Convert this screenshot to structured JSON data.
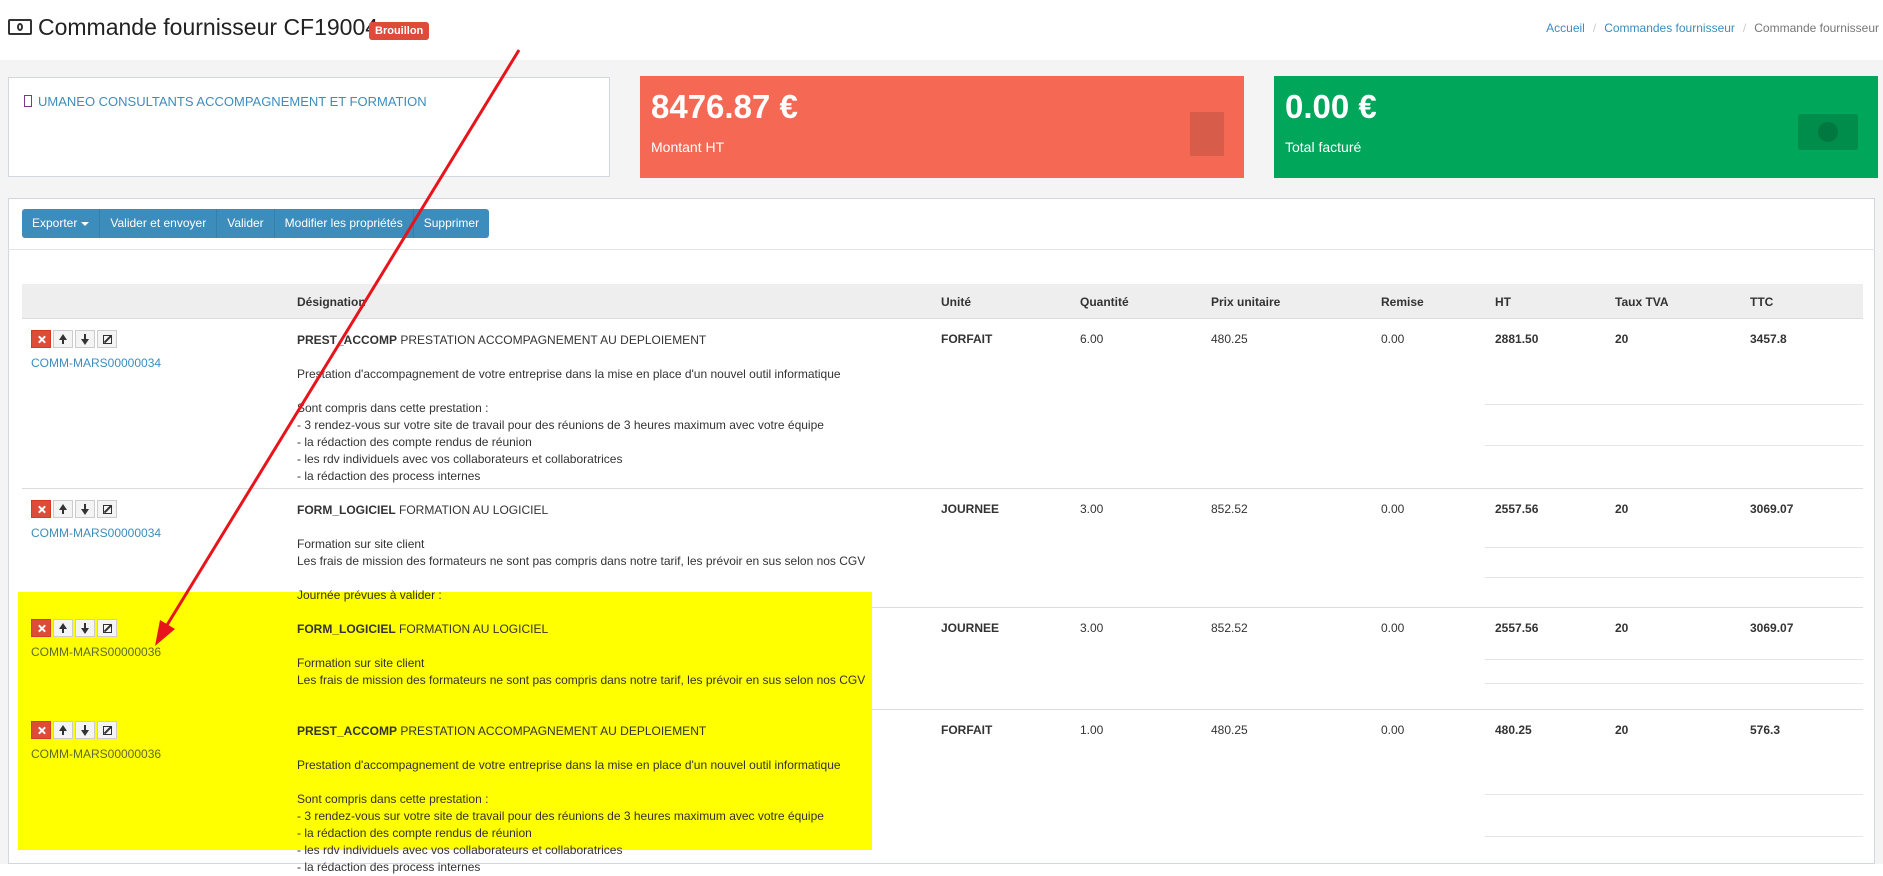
{
  "header": {
    "title": "Commande fournisseur CF19004",
    "status": "Brouillon",
    "breadcrumb": [
      "Accueil",
      "Commandes fournisseur",
      "Commande fournisseur"
    ]
  },
  "supplier": {
    "name": "UMANEO CONSULTANTS ACCOMPAGNEMENT ET FORMATION"
  },
  "kpis": [
    {
      "value": "8476.87 €",
      "label": "Montant HT",
      "color": "#f56954"
    },
    {
      "value": "0.00 €",
      "label": "Total facturé",
      "color": "#00a65a"
    }
  ],
  "toolbar": {
    "export": "Exporter",
    "validate_send": "Valider et envoyer",
    "validate": "Valider",
    "modify": "Modifier les propriétés",
    "delete": "Supprimer"
  },
  "table": {
    "headers": {
      "designation": "Désignation",
      "unit": "Unité",
      "qty": "Quantité",
      "price": "Prix unitaire",
      "discount": "Remise",
      "ht": "HT",
      "vat": "Taux TVA",
      "ttc": "TTC"
    },
    "rows": [
      {
        "ref": "COMM-MARS00000034",
        "code": "PREST_ACCOMP",
        "label": "PRESTATION ACCOMPAGNEMENT AU DEPLOIEMENT",
        "description": "Prestation d'accompagnement de votre entreprise dans la mise en place d'un nouvel outil informatique\n\nSont compris dans cette prestation :\n- 3 rendez-vous sur votre site de travail pour des réunions de 3 heures maximum avec votre équipe\n- la rédaction des compte rendus de réunion\n- les rdv individuels avec vos collaborateurs et collaboratrices\n- la rédaction des process internes",
        "unit": "FORFAIT",
        "qty": "6.00",
        "price": "480.25",
        "discount": "0.00",
        "ht": "2881.50",
        "vat": "20",
        "ttc": "3457.8"
      },
      {
        "ref": "COMM-MARS00000034",
        "code": "FORM_LOGICIEL",
        "label": "FORMATION AU LOGICIEL",
        "description": "Formation sur site client\nLes frais de mission des formateurs ne sont pas compris dans notre tarif, les prévoir en sus selon nos CGV\n\nJournée prévues à valider :",
        "unit": "JOURNEE",
        "qty": "3.00",
        "price": "852.52",
        "discount": "0.00",
        "ht": "2557.56",
        "vat": "20",
        "ttc": "3069.07"
      },
      {
        "ref": "COMM-MARS00000036",
        "code": "FORM_LOGICIEL",
        "label": "FORMATION AU LOGICIEL",
        "description": "Formation sur site client\nLes frais de mission des formateurs ne sont pas compris dans notre tarif, les prévoir en sus selon nos CGV",
        "unit": "JOURNEE",
        "qty": "3.00",
        "price": "852.52",
        "discount": "0.00",
        "ht": "2557.56",
        "vat": "20",
        "ttc": "3069.07"
      },
      {
        "ref": "COMM-MARS00000036",
        "code": "PREST_ACCOMP",
        "label": "PRESTATION ACCOMPAGNEMENT AU DEPLOIEMENT",
        "description": "Prestation d'accompagnement de votre entreprise dans la mise en place d'un nouvel outil informatique\n\nSont compris dans cette prestation :\n- 3 rendez-vous sur votre site de travail pour des réunions de 3 heures maximum avec votre équipe\n- la rédaction des compte rendus de réunion\n- les rdv individuels avec vos collaborateurs et collaboratrices\n- la rédaction des process internes",
        "unit": "FORFAIT",
        "qty": "1.00",
        "price": "480.25",
        "discount": "0.00",
        "ht": "480.25",
        "vat": "20",
        "ttc": "576.3"
      }
    ]
  },
  "annotation": {
    "highlight_color": "#ffff00",
    "arrow_color": "#e8141b"
  }
}
